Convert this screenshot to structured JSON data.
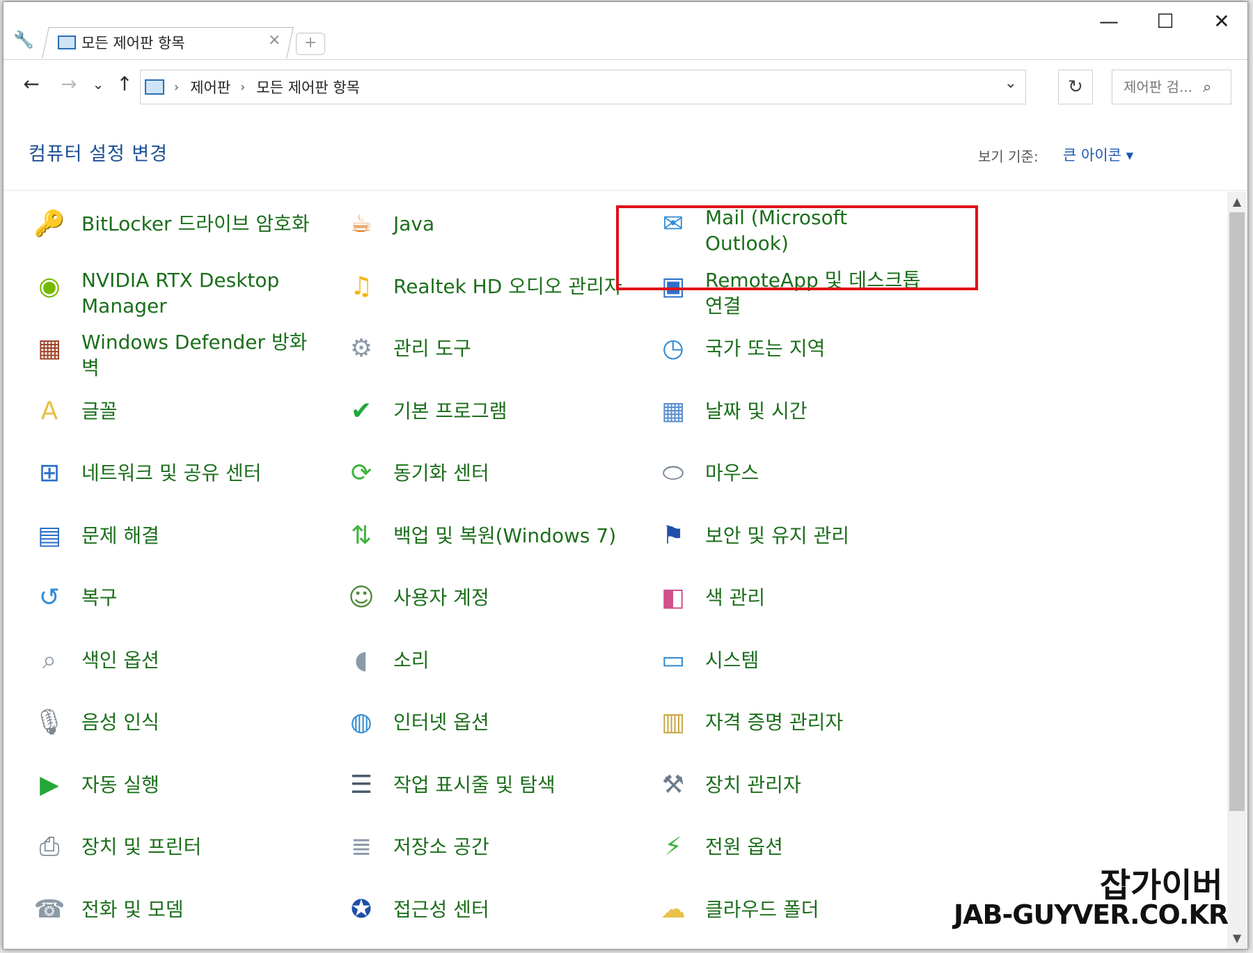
{
  "window": {
    "tab_title": "모든 제어판 항목",
    "tab_close": "×",
    "new_tab": "+",
    "minimize": "—",
    "maximize": "☐",
    "close": "✕"
  },
  "nav": {
    "back": "←",
    "forward": "→",
    "recent": "⌄",
    "up": "↑",
    "breadcrumb": [
      "제어판",
      "모든 제어판 항목"
    ],
    "separator": "›",
    "dropdown": "⌄",
    "refresh": "↻",
    "search_placeholder": "제어판 검...",
    "search_icon": "⌕"
  },
  "header": {
    "title": "컴퓨터 설정 변경",
    "view_by_label": "보기 기준:",
    "view_by_value": "큰 아이콘 ▾"
  },
  "items": [
    {
      "label": "BitLocker 드라이브 암호화",
      "icon": "bitlocker-icon",
      "color": "#d8a630"
    },
    {
      "label": "Java",
      "icon": "java-icon",
      "color": "#e07a1f"
    },
    {
      "label": "Mail (Microsoft Outlook)",
      "icon": "mail-icon",
      "color": "#2f8bd6"
    },
    {
      "label": "NVIDIA RTX Desktop Manager",
      "icon": "nvidia-icon",
      "color": "#76b900"
    },
    {
      "label": "Realtek HD 오디오 관리자",
      "icon": "realtek-audio-icon",
      "color": "#f5b400"
    },
    {
      "label": "RemoteApp 및 데스크톱 연결",
      "icon": "remoteapp-icon",
      "color": "#2b6fc7"
    },
    {
      "label": "Windows Defender 방화벽",
      "icon": "firewall-icon",
      "color": "#a0442a"
    },
    {
      "label": "관리 도구",
      "icon": "admin-tools-icon",
      "color": "#8c9aa8"
    },
    {
      "label": "국가 또는 지역",
      "icon": "region-icon",
      "color": "#2f8bd6"
    },
    {
      "label": "글꼴",
      "icon": "fonts-icon",
      "color": "#e8c04a"
    },
    {
      "label": "기본 프로그램",
      "icon": "default-programs-icon",
      "color": "#22a838"
    },
    {
      "label": "날짜 및 시간",
      "icon": "date-time-icon",
      "color": "#5a8fd0"
    },
    {
      "label": "네트워크 및 공유 센터",
      "icon": "network-icon",
      "color": "#2b6fc7"
    },
    {
      "label": "동기화 센터",
      "icon": "sync-center-icon",
      "color": "#3db33d"
    },
    {
      "label": "마우스",
      "icon": "mouse-icon",
      "color": "#6d7c8a"
    },
    {
      "label": "문제 해결",
      "icon": "troubleshoot-icon",
      "color": "#2b6fc7"
    },
    {
      "label": "백업 및 복원(Windows 7)",
      "icon": "backup-icon",
      "color": "#3db33d"
    },
    {
      "label": "보안 및 유지 관리",
      "icon": "security-flag-icon",
      "color": "#1f4fa8"
    },
    {
      "label": "복구",
      "icon": "recovery-icon",
      "color": "#2f8bd6"
    },
    {
      "label": "사용자 계정",
      "icon": "user-accounts-icon",
      "color": "#4f8a3a"
    },
    {
      "label": "색 관리",
      "icon": "color-management-icon",
      "color": "#d04f8c"
    },
    {
      "label": "색인 옵션",
      "icon": "indexing-icon",
      "color": "#8c9aa8"
    },
    {
      "label": "소리",
      "icon": "sound-icon",
      "color": "#8c9aa8"
    },
    {
      "label": "시스템",
      "icon": "system-icon",
      "color": "#2f8bd6"
    },
    {
      "label": "음성 인식",
      "icon": "microphone-icon",
      "color": "#7d8790"
    },
    {
      "label": "인터넷 옵션",
      "icon": "internet-options-icon",
      "color": "#2f8bd6"
    },
    {
      "label": "자격 증명 관리자",
      "icon": "credential-manager-icon",
      "color": "#c9a440"
    },
    {
      "label": "자동 실행",
      "icon": "autoplay-icon",
      "color": "#22a838"
    },
    {
      "label": "작업 표시줄 및 탐색",
      "icon": "taskbar-icon",
      "color": "#4a5a6a"
    },
    {
      "label": "장치 관리자",
      "icon": "device-manager-icon",
      "color": "#6d7c8a"
    },
    {
      "label": "장치 및 프린터",
      "icon": "printer-icon",
      "color": "#6d7c8a"
    },
    {
      "label": "저장소 공간",
      "icon": "storage-spaces-icon",
      "color": "#8c9aa8"
    },
    {
      "label": "전원 옵션",
      "icon": "power-options-icon",
      "color": "#3db33d"
    },
    {
      "label": "전화 및 모뎀",
      "icon": "phone-modem-icon",
      "color": "#8c9aa8"
    },
    {
      "label": "접근성 센터",
      "icon": "ease-of-access-icon",
      "color": "#1f4fa8"
    },
    {
      "label": "클라우드 폴더",
      "icon": "cloud-folder-icon",
      "color": "#e8c04a"
    }
  ],
  "watermark": {
    "line1": "잡가이버",
    "line2": "JAB-GUYVER.CO.KR"
  }
}
